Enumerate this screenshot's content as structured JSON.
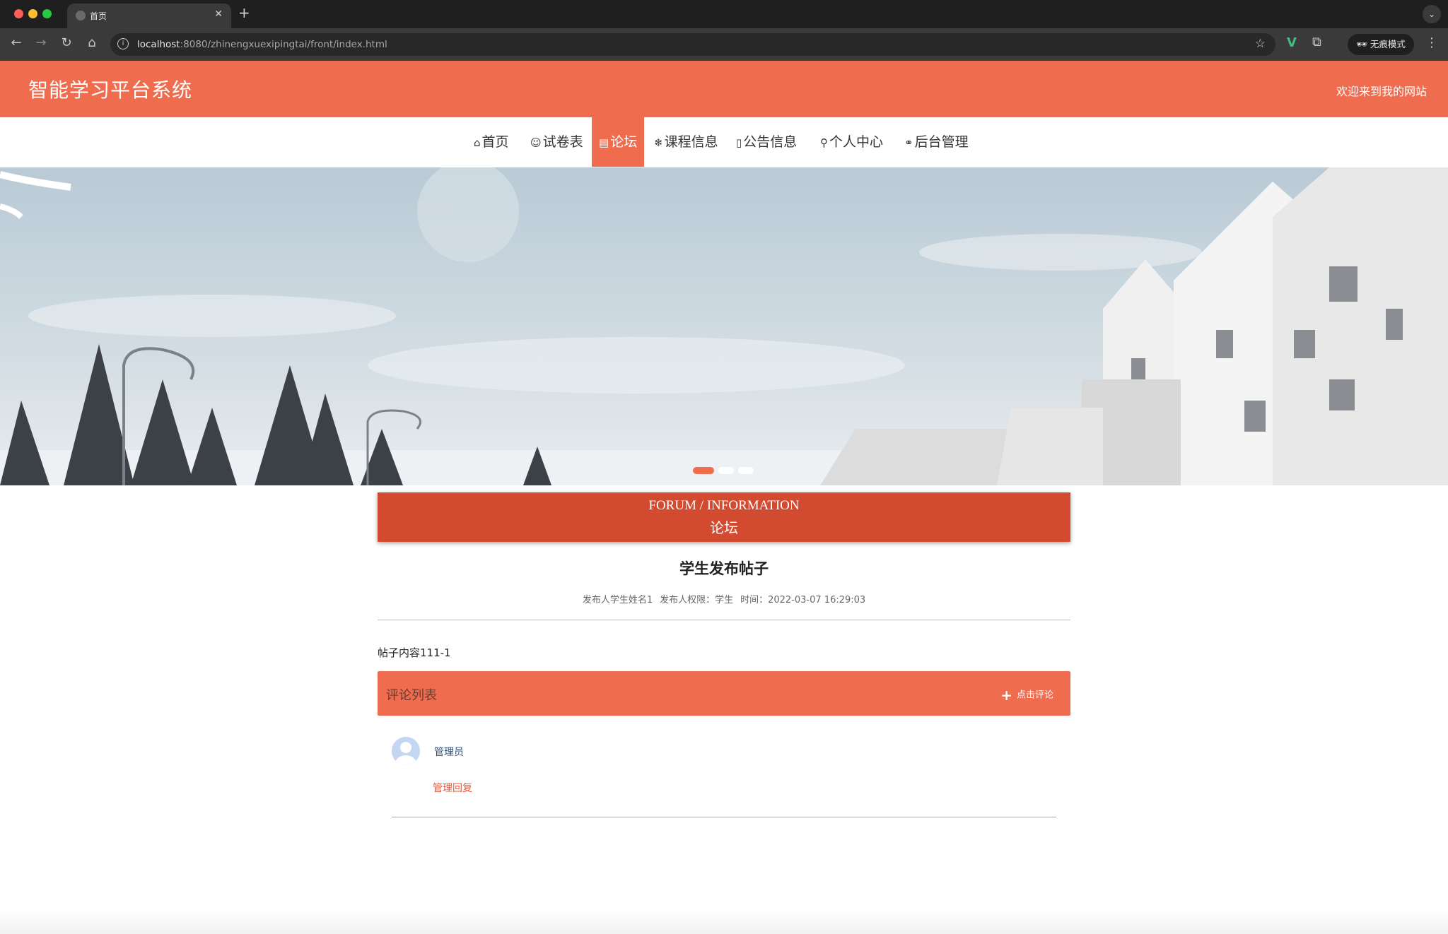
{
  "browser": {
    "tab_title": "首页",
    "url_host": "localhost",
    "url_rest": ":8080/zhinengxuexipingtai/front/index.html",
    "incognito_label": "无痕模式"
  },
  "site": {
    "title": "智能学习平台系统",
    "welcome": "欢迎来到我的网站"
  },
  "nav": {
    "items": [
      {
        "icon": "⌂",
        "label": "首页"
      },
      {
        "icon": "☺",
        "label": "试卷表"
      },
      {
        "icon": "▤",
        "label": "论坛"
      },
      {
        "icon": "❄",
        "label": "课程信息"
      },
      {
        "icon": "▯",
        "label": "公告信息"
      },
      {
        "icon": "⚲",
        "label": "个人中心"
      },
      {
        "icon": "⚭",
        "label": "后台管理"
      }
    ],
    "active_index": 2
  },
  "carousel": {
    "slide_count": 3,
    "active": 0
  },
  "section": {
    "title_en": "FORUM / INFORMATION",
    "title_zh": "论坛"
  },
  "post": {
    "title": "学生发布帖子",
    "author": "发布人学生姓名1",
    "role": "发布人权限：学生",
    "time": "时间：2022-03-07 16:29:03",
    "content": "帖子内容111-1"
  },
  "comments": {
    "header": "评论列表",
    "add_label": "点击评论",
    "items": [
      {
        "user": "管理员",
        "text": "管理回复"
      }
    ]
  },
  "colors": {
    "brand": "#f06c4e",
    "section_banner": "#d24a30"
  }
}
